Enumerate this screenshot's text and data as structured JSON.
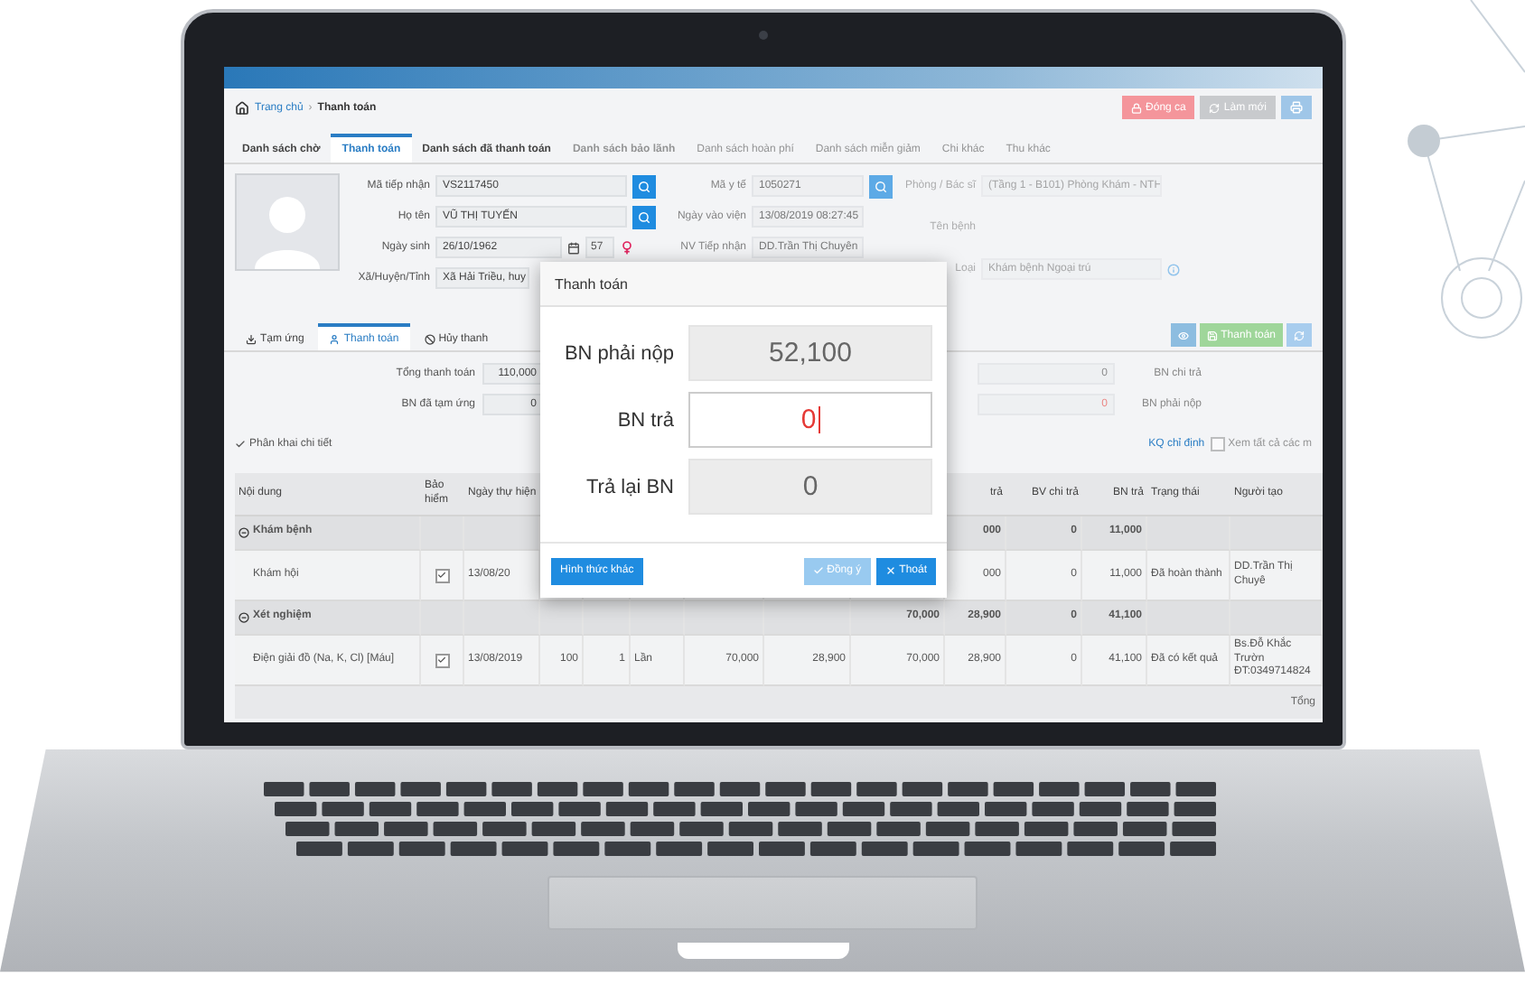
{
  "breadcrumb": {
    "home": "Trang chủ",
    "separator": "›",
    "current": "Thanh toán"
  },
  "header_buttons": [
    {
      "label": "Đóng ca",
      "kind": "danger"
    },
    {
      "label": "Làm mới",
      "kind": "neutral"
    },
    {
      "kind": "primary"
    }
  ],
  "tabs": [
    {
      "label": "Danh sách chờ",
      "selected": false
    },
    {
      "label": "Thanh toán",
      "selected": true
    },
    {
      "label": "Danh sách đã thanh toán",
      "selected": false
    },
    {
      "label": "Danh sách bảo lãnh",
      "selected": false
    },
    {
      "label": "Danh sách hoàn phí",
      "selected": false
    },
    {
      "label": "Danh sách miễn giảm",
      "selected": false
    },
    {
      "label": "Chi khác",
      "selected": false
    },
    {
      "label": "Thu khác",
      "selected": false
    }
  ],
  "patient_left": [
    {
      "label": "Mã tiếp nhận",
      "value": "VS2117450",
      "kind": "search"
    },
    {
      "label": "Họ tên",
      "value": "VŨ THỊ TUYẾN",
      "kind": "search"
    },
    {
      "label": "Ngày sinh",
      "value": "26/10/1962",
      "age": "57",
      "kind": "date"
    },
    {
      "label": "Xã/Huyện/Tỉnh",
      "value": "Xã Hải Triều, huy",
      "kind": "short"
    }
  ],
  "patient_middle": [
    {
      "label": "Mã y tế",
      "value": "1050271",
      "kind": "search"
    },
    {
      "label": "Ngày vào viện",
      "value": "13/08/2019 08:27:45",
      "kind": "plain"
    },
    {
      "label": "NV Tiếp nhận",
      "value": "DD.Trần Thị Chuyên",
      "kind": "plain"
    }
  ],
  "patient_right": [
    {
      "label": "Phòng / Bác sĩ",
      "value": "(Tầng 1 - B101) Phòng Khám - NTH"
    },
    {
      "label": "Tên bệnh"
    },
    {
      "label": "Loại",
      "value": "Khám bệnh Ngoại trú"
    }
  ],
  "sub_tabs": [
    {
      "label": "Tạm ứng",
      "selected": false
    },
    {
      "label": "Thanh toán",
      "selected": true
    },
    {
      "label": "Hủy thanh",
      "selected": false
    }
  ],
  "action_buttons": [
    {
      "kind": "view"
    },
    {
      "kind": "pay",
      "label": "Thanh toán"
    },
    {
      "kind": "refresh"
    }
  ],
  "totals": [
    {
      "label": "Tổng thanh toán",
      "value": "110,000",
      "other_value": "0",
      "alert": false,
      "right_label": "BN chi trả"
    },
    {
      "label": "BN đã tạm ứng",
      "value": "0",
      "other_value": "0",
      "alert": true,
      "right_label": "BN phải nộp"
    }
  ],
  "detail_toggle": {
    "label": "Phân khai chi tiết",
    "checked": true
  },
  "result_link": "KQ chỉ định",
  "show_all": {
    "label": "Xem tất cả các m",
    "checked": false
  },
  "table": {
    "columns": [
      "Nội dung",
      "Bảo hiểm",
      "Ngày thự hiện",
      null,
      null,
      null,
      null,
      null,
      null,
      "trả",
      "BV chi trả",
      "BN trả",
      "Trạng thái",
      "Người tạo"
    ],
    "rows": [
      {
        "kind": "group",
        "cells": [
          "Khám bệnh",
          null,
          null,
          null,
          null,
          null,
          null,
          null,
          null,
          "000",
          "0",
          "11,000",
          null,
          null
        ]
      },
      {
        "kind": "item",
        "insured": true,
        "cells": [
          "Khám hội",
          null,
          "13/08/20",
          null,
          null,
          null,
          null,
          null,
          null,
          "000",
          "0",
          "11,000",
          "Đã hoàn thành",
          "DD.Trần Thị Chuyê"
        ]
      },
      {
        "kind": "group",
        "cells": [
          "Xét nghiệm",
          null,
          null,
          null,
          null,
          null,
          null,
          null,
          "70,000",
          "28,900",
          "0",
          "41,100",
          null,
          null
        ]
      },
      {
        "kind": "item",
        "insured": true,
        "cells": [
          "Điện giải đồ (Na, K, Cl) [Máu]",
          null,
          "13/08/2019",
          "100",
          "1",
          "Lần",
          "70,000",
          "28,900",
          "70,000",
          "28,900",
          "0",
          "41,100",
          "Đã có kết quả",
          "Bs.Đỗ Khắc Trườn ĐT:0349714824"
        ]
      }
    ],
    "footer": "Tổng"
  },
  "modal": {
    "title": "Thanh toán",
    "rows": [
      {
        "label": "BN phải nộp",
        "value": "52,100",
        "editable": false
      },
      {
        "label": "BN trả",
        "value": "0",
        "editable": true
      },
      {
        "label": "Trả lại BN",
        "value": "0",
        "editable": false
      }
    ],
    "buttons": [
      {
        "label": "Hình thức khác",
        "kind": "secondary",
        "disabled": false
      },
      {
        "label": "Đồng ý",
        "kind": "confirm",
        "disabled": true
      },
      {
        "label": "Thoát",
        "kind": "close",
        "disabled": false
      }
    ]
  }
}
